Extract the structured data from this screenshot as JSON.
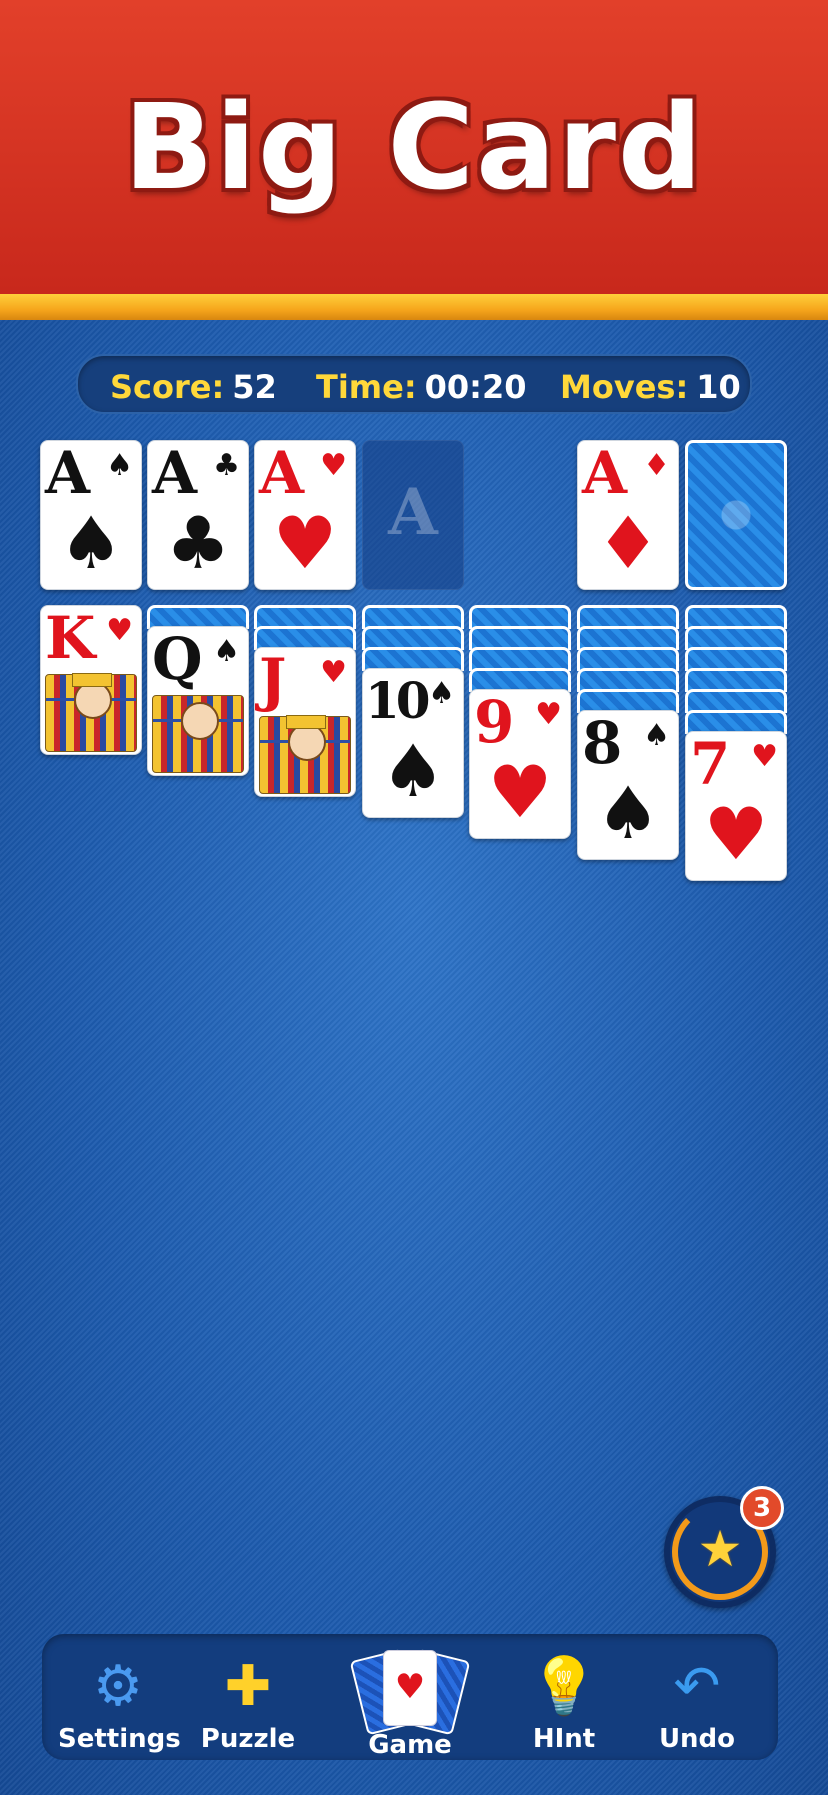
{
  "header": {
    "title": "Big Card"
  },
  "status": {
    "score_label": "Score:",
    "score_value": "52",
    "time_label": "Time:",
    "time_value": "00:20",
    "moves_label": "Moves:",
    "moves_value": "10"
  },
  "foundations": [
    {
      "rank": "A",
      "suit": "♠",
      "color": "black"
    },
    {
      "rank": "A",
      "suit": "♣",
      "color": "black"
    },
    {
      "rank": "A",
      "suit": "♥",
      "color": "red"
    },
    {
      "empty_label": "A"
    }
  ],
  "waste": {
    "rank": "A",
    "suit": "♦",
    "color": "red"
  },
  "tableau": [
    {
      "hidden": 0,
      "rank": "K",
      "suit": "♥",
      "color": "red"
    },
    {
      "hidden": 1,
      "rank": "Q",
      "suit": "♠",
      "color": "black"
    },
    {
      "hidden": 2,
      "rank": "J",
      "suit": "♥",
      "color": "red"
    },
    {
      "hidden": 3,
      "rank": "10",
      "suit": "♠",
      "color": "black"
    },
    {
      "hidden": 4,
      "rank": "9",
      "suit": "♥",
      "color": "red"
    },
    {
      "hidden": 5,
      "rank": "8",
      "suit": "♠",
      "color": "black"
    },
    {
      "hidden": 6,
      "rank": "7",
      "suit": "♥",
      "color": "red"
    }
  ],
  "magic_wand": {
    "count": "3",
    "icon": "magic-wand-star-icon"
  },
  "toolbar": {
    "settings": {
      "label": "Settings",
      "icon": "gear-icon"
    },
    "puzzle": {
      "label": "Puzzle",
      "icon": "puzzle-icon"
    },
    "game": {
      "label": "Game",
      "icon": "cards-icon"
    },
    "hint": {
      "label": "HInt",
      "icon": "lightbulb-icon"
    },
    "undo": {
      "label": "Undo",
      "icon": "undo-arrow-icon"
    }
  },
  "colors": {
    "banner_red": "#d8301f",
    "felt_blue": "#1d5db4",
    "status_yellow": "#ffd83a",
    "card_red": "#e0141d"
  }
}
